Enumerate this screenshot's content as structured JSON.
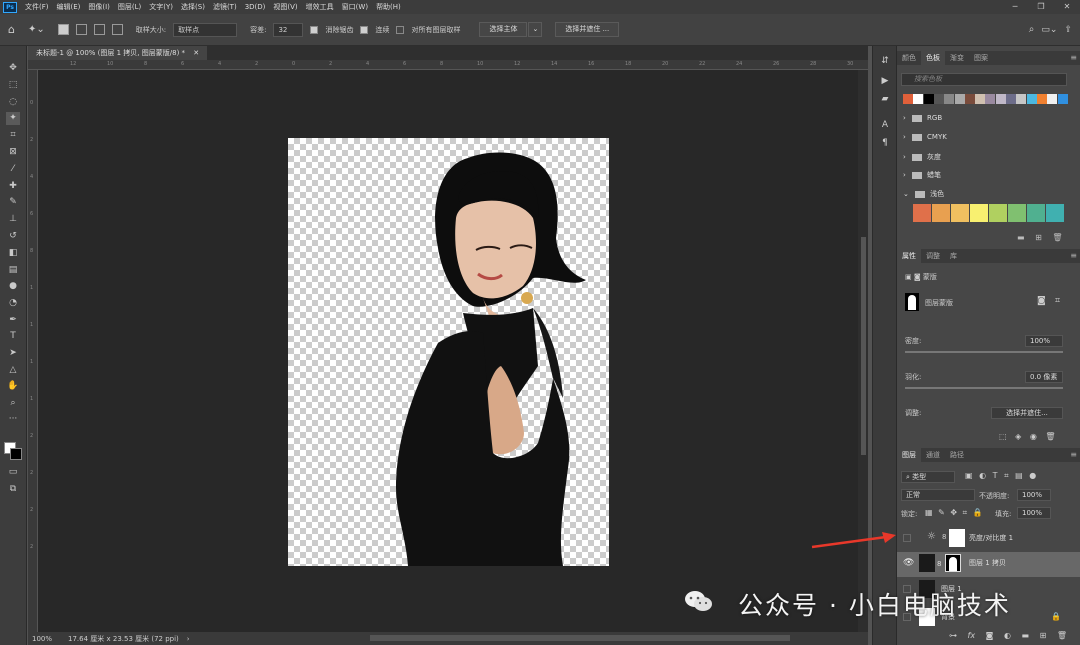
{
  "app": {
    "logo": "Ps"
  },
  "menu": [
    "文件(F)",
    "编辑(E)",
    "图像(I)",
    "图层(L)",
    "文字(Y)",
    "选择(S)",
    "滤镜(T)",
    "3D(D)",
    "视图(V)",
    "增效工具",
    "窗口(W)",
    "帮助(H)"
  ],
  "options": {
    "sample_size_label": "取样大小:",
    "sample_size_value": "取样点",
    "tolerance_label": "容差:",
    "tolerance_value": "32",
    "antialias": "消除锯齿",
    "contiguous": "连续",
    "all_layers": "对所有图层取样",
    "select_subject": "选择主体",
    "select_mask": "选择并遮住 ..."
  },
  "document": {
    "tab_title": "未标题-1 @ 100% (图层 1 拷贝, 图层蒙版/8) *",
    "zoom": "100%",
    "doc_info": "17.64 厘米 x 23.53 厘米 (72 ppi)"
  },
  "ruler": {
    "h": [
      "12",
      "10",
      "8",
      "6",
      "4",
      "2",
      "0",
      "2",
      "4",
      "6",
      "8",
      "10",
      "12",
      "14",
      "16",
      "18",
      "20",
      "22",
      "24",
      "26",
      "28",
      "30"
    ],
    "v": [
      "0",
      "2",
      "4",
      "6",
      "8",
      "1",
      "1",
      "1",
      "1",
      "2",
      "2",
      "2",
      "2"
    ]
  },
  "swatches_panel": {
    "tabs": [
      "颜色",
      "色板",
      "渐变",
      "图案"
    ],
    "search_placeholder": "搜索色板",
    "row_colors": [
      "#e0603a",
      "#ffffff",
      "#000000",
      "#555555",
      "#888888",
      "#aaaaaa",
      "#7a4c3c",
      "#d0c0b0",
      "#9a8aa0",
      "#c0b8c8",
      "#6d6d8a",
      "#c6c6c6",
      "#4cb8e0",
      "#f08030",
      "#f0f0f0",
      "#3090e0"
    ],
    "folders": [
      "RGB",
      "CMYK",
      "灰度",
      "蜡笔",
      "浅色"
    ],
    "big_swatches": [
      "#e0704a",
      "#e8a050",
      "#f0c060",
      "#f8f070",
      "#b0d060",
      "#80c070",
      "#50b090",
      "#40b0b0"
    ]
  },
  "properties_panel": {
    "tabs": [
      "属性",
      "调整",
      "库"
    ],
    "mask_label": "蒙版",
    "layer_mask_label": "图层蒙版",
    "density_label": "密度:",
    "density_value": "100%",
    "feather_label": "羽化:",
    "feather_value": "0.0 像素",
    "refine_label": "调整:",
    "refine_button": "选择并遮住..."
  },
  "layers_panel": {
    "tabs": [
      "图层",
      "通道",
      "路径"
    ],
    "filter_label": "类型",
    "blend_mode": "正常",
    "opacity_label": "不透明度:",
    "opacity_value": "100%",
    "lock_label": "锁定:",
    "fill_label": "填充:",
    "fill_value": "100%",
    "layers": [
      {
        "name": "亮度/对比度 1"
      },
      {
        "name": "图层 1 拷贝"
      },
      {
        "name": "图层 1"
      },
      {
        "name": "背景"
      }
    ]
  },
  "watermark": "公众号 · 小白电脑技术"
}
